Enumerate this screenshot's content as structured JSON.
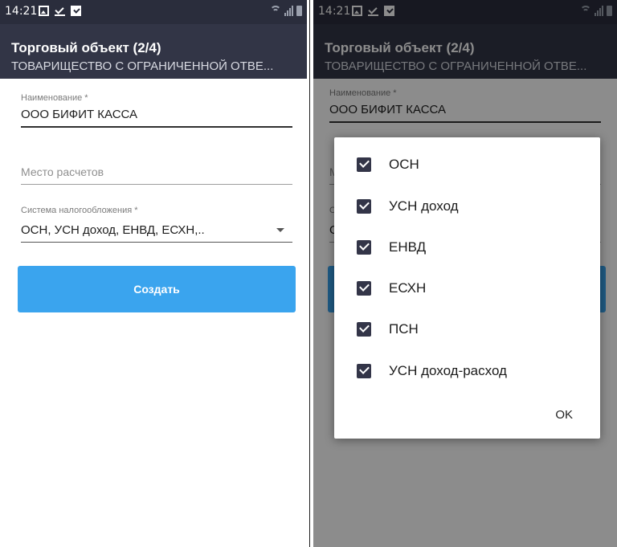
{
  "status": {
    "time": "14:21"
  },
  "appbar": {
    "title": "Торговый объект (2/4)",
    "subtitle": "ТОВАРИЩЕСТВО С ОГРАНИЧЕННОЙ ОТВЕ..."
  },
  "form": {
    "name_label": "Наименование *",
    "name_value": "ООО БИФИТ КАССА",
    "place_placeholder": "Место расчетов",
    "tax_label": "Система налогообложения *",
    "tax_value": "ОСН, УСН доход, ЕНВД, ЕСХН,..",
    "submit_label": "Создать"
  },
  "dialog": {
    "options": [
      {
        "label": "ОСН",
        "checked": true
      },
      {
        "label": "УСН доход",
        "checked": true
      },
      {
        "label": "ЕНВД",
        "checked": true
      },
      {
        "label": "ЕСХН",
        "checked": true
      },
      {
        "label": "ПСН",
        "checked": true
      },
      {
        "label": "УСН доход-расход",
        "checked": true
      }
    ],
    "ok_label": "OK"
  },
  "colors": {
    "statusbar": "#2a2d3c",
    "appbar": "#323546",
    "button": "#3aa4ee",
    "checkbox": "#333548"
  }
}
